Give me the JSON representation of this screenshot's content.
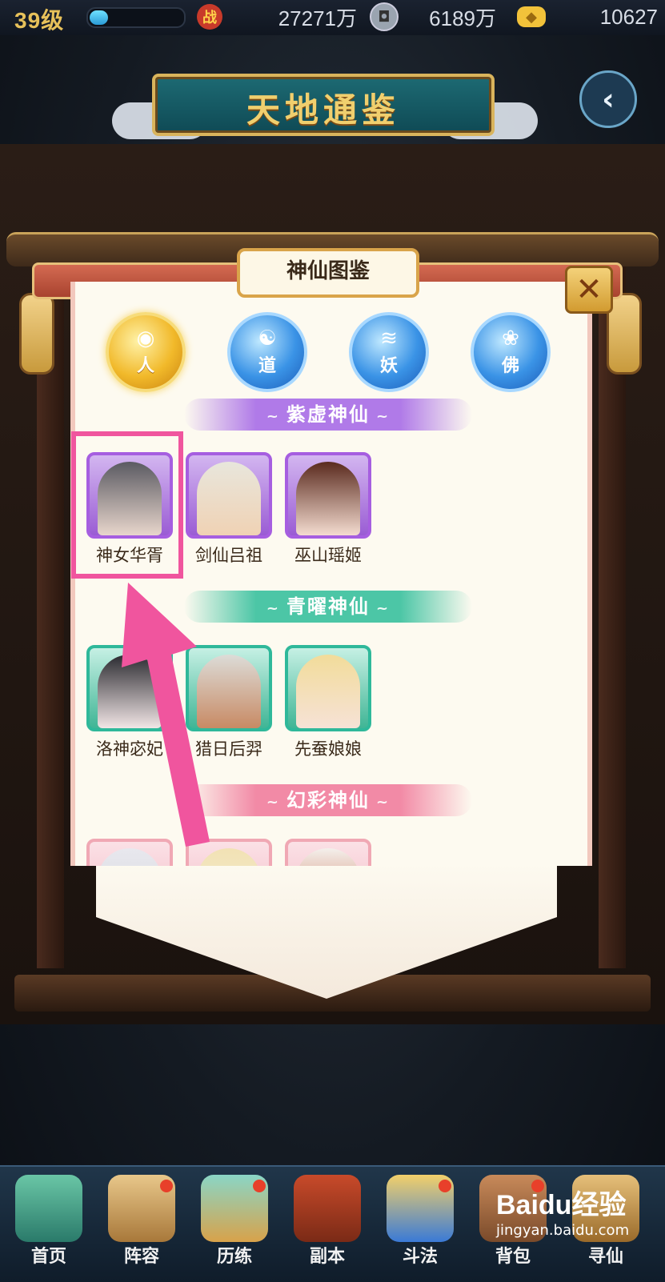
{
  "topbar": {
    "level": "39级",
    "xp_fraction": 0.2,
    "power_icon": "战",
    "power_value": "27271万",
    "coins_value": "6189万",
    "ingots_value": "10627"
  },
  "header": {
    "title": "天地通鉴"
  },
  "panel": {
    "title": "神仙图鉴"
  },
  "categories": [
    {
      "label": "人",
      "state": "active"
    },
    {
      "label": "道",
      "state": "normal"
    },
    {
      "label": "妖",
      "state": "normal"
    },
    {
      "label": "佛",
      "state": "normal"
    }
  ],
  "sections": [
    {
      "title": "紫虚神仙",
      "color": "#b07ae8",
      "characters": [
        "神女华胥",
        "剑仙吕祖",
        "巫山瑶姬"
      ]
    },
    {
      "title": "青曜神仙",
      "color": "#4cc6a6",
      "characters": [
        "洛神宓妃",
        "猎日后羿",
        "先蚕娘娘"
      ]
    },
    {
      "title": "幻彩神仙",
      "color": "#f28aa6",
      "characters": [
        "",
        "",
        ""
      ]
    }
  ],
  "highlight_color": "#f0559e",
  "nav": [
    {
      "label": "首页",
      "icon": "home-icon",
      "dot": false
    },
    {
      "label": "阵容",
      "icon": "lineup-icon",
      "dot": true
    },
    {
      "label": "历练",
      "icon": "training-icon",
      "dot": true
    },
    {
      "label": "副本",
      "icon": "dungeon-icon",
      "dot": false
    },
    {
      "label": "斗法",
      "icon": "battle-icon",
      "dot": true
    },
    {
      "label": "背包",
      "icon": "bag-icon",
      "dot": true
    },
    {
      "label": "寻仙",
      "icon": "seek-immortal-icon",
      "dot": false
    }
  ],
  "watermark": {
    "brand": "Baidu经验",
    "url": "jingyan.baidu.com"
  }
}
